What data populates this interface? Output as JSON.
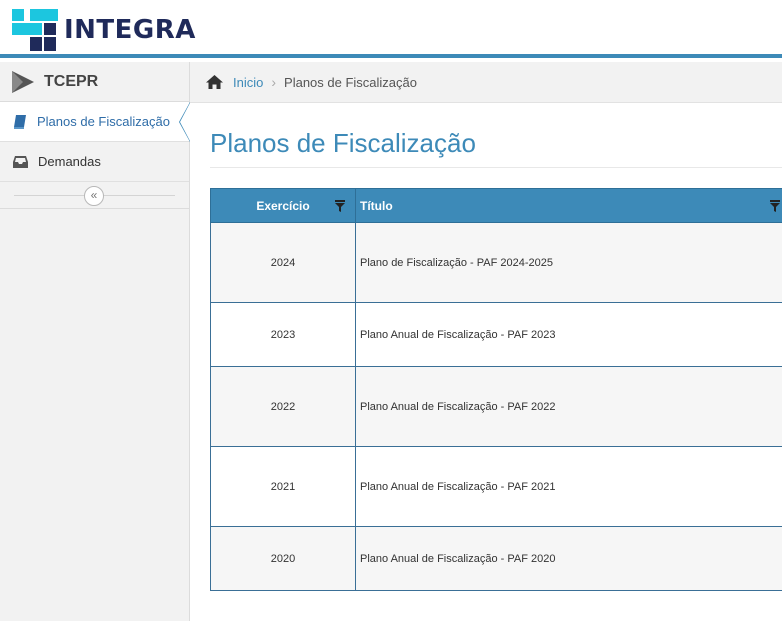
{
  "header": {
    "logo_text": "INTEGRA"
  },
  "sidebar": {
    "brand": "TCEPR",
    "items": [
      {
        "label": "Planos de Fiscalização",
        "icon": "book-icon",
        "active": true
      },
      {
        "label": "Demandas",
        "icon": "inbox-icon",
        "active": false
      }
    ],
    "collapse_glyph": "«"
  },
  "breadcrumb": {
    "home": "Inicio",
    "separator": "›",
    "current": "Planos de Fiscalização"
  },
  "main": {
    "title": "Planos de Fiscalização",
    "table": {
      "columns": [
        "Exercício",
        "Título"
      ],
      "rows": [
        {
          "exercicio": "2024",
          "titulo": "Plano de Fiscalização - PAF 2024-2025"
        },
        {
          "exercicio": "2023",
          "titulo": "Plano Anual de Fiscalização - PAF 2023"
        },
        {
          "exercicio": "2022",
          "titulo": "Plano Anual de Fiscalização - PAF 2022"
        },
        {
          "exercicio": "2021",
          "titulo": "Plano Anual de Fiscalização - PAF 2021"
        },
        {
          "exercicio": "2020",
          "titulo": "Plano Anual de Fiscalização - PAF 2020"
        }
      ]
    }
  },
  "colors": {
    "accent": "#3d8ab8",
    "logo_navy": "#1f2a5a",
    "logo_cyan": "#1cc6df"
  }
}
